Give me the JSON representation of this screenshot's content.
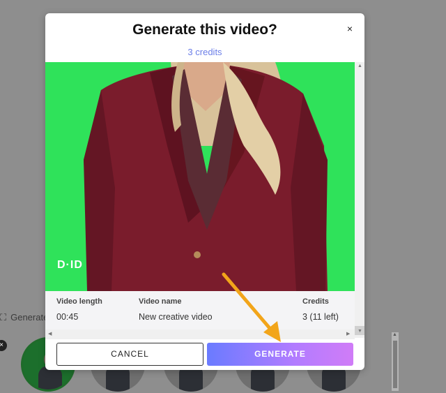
{
  "background": {
    "section_label": "Generate",
    "badge": "×"
  },
  "modal": {
    "title": "Generate this video?",
    "close_label": "×",
    "credits_note": "3 credits",
    "watermark": "D·ID",
    "info": {
      "video_length_label": "Video length",
      "video_length_value": "00:45",
      "video_name_label": "Video name",
      "video_name_value": "New creative video",
      "credits_label": "Credits",
      "credits_value": "3 (11 left)"
    },
    "cancel_label": "CANCEL",
    "generate_label": "GENERATE"
  },
  "colors": {
    "accent_link": "#6b7ee8",
    "green_screen": "#2fe25a",
    "generate_gradient_start": "#6a7bff",
    "generate_gradient_end": "#d07cf7",
    "annotation_arrow": "#f2a51a"
  },
  "icons": [
    "close-icon",
    "arrow-annotation-icon",
    "scroll-arrow-icon",
    "generate-icon"
  ]
}
